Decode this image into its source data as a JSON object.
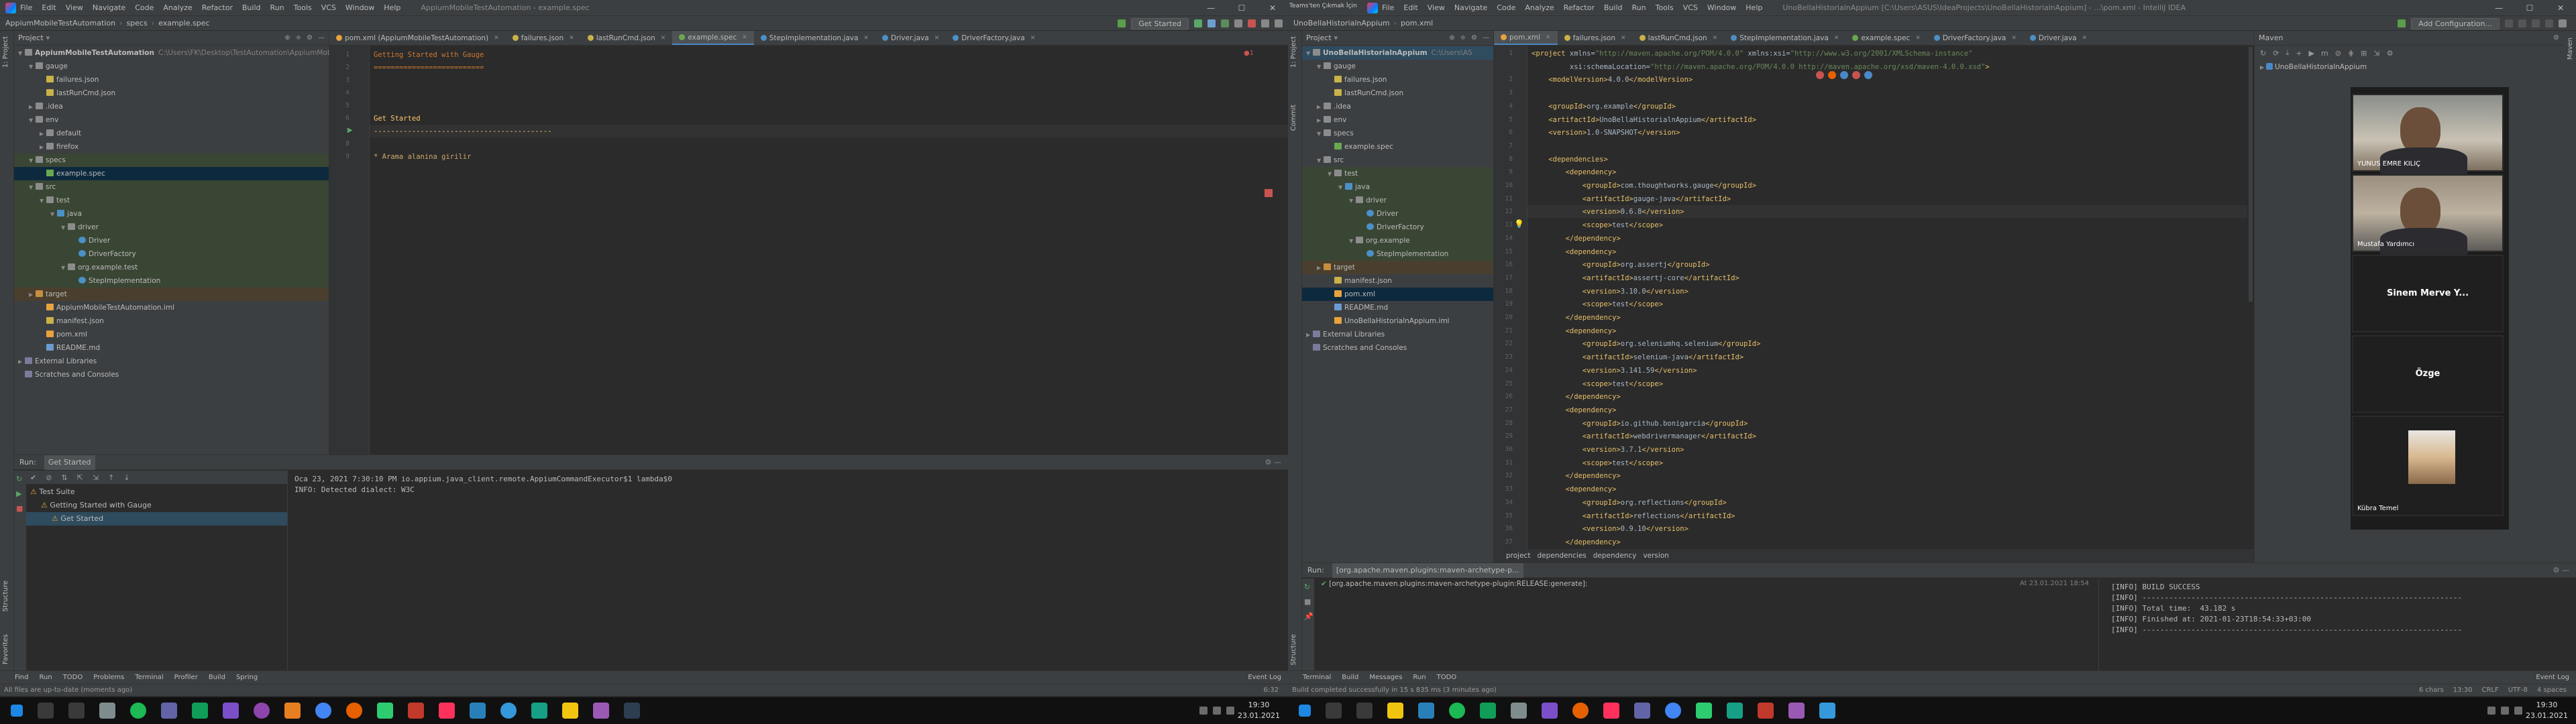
{
  "left": {
    "title": {
      "menu": [
        "File",
        "Edit",
        "View",
        "Navigate",
        "Code",
        "Analyze",
        "Refactor",
        "Build",
        "Run",
        "Tools",
        "VCS",
        "Window",
        "Help"
      ],
      "window_title": "AppiumMobileTestAutomation - example.spec"
    },
    "nav": {
      "crumbs": [
        "AppiumMobileTestAutomation",
        "specs",
        "example.spec"
      ],
      "run_config": "Get Started"
    },
    "project": {
      "header": "Project",
      "tree": [
        {
          "label": "AppiumMobileTestAutomation",
          "extra": "C:\\Users\\FK\\Desktop\\TestAutomation\\AppiumMobileTestAutomationProject",
          "indent": 0,
          "icon": "folder",
          "arrow": "▼"
        },
        {
          "label": "gauge",
          "indent": 1,
          "icon": "folder",
          "arrow": "▼"
        },
        {
          "label": "failures.json",
          "indent": 2,
          "icon": "json",
          "arrow": ""
        },
        {
          "label": "lastRunCmd.json",
          "indent": 2,
          "icon": "json",
          "arrow": ""
        },
        {
          "label": ".idea",
          "indent": 1,
          "icon": "folder",
          "arrow": "▶"
        },
        {
          "label": "env",
          "indent": 1,
          "icon": "folder",
          "arrow": "▼"
        },
        {
          "label": "default",
          "indent": 2,
          "icon": "folder",
          "arrow": "▶"
        },
        {
          "label": "firefox",
          "indent": 2,
          "icon": "folder",
          "arrow": "▶"
        },
        {
          "label": "specs",
          "indent": 1,
          "icon": "folder",
          "arrow": "▼",
          "hl": "green"
        },
        {
          "label": "example.spec",
          "indent": 2,
          "icon": "spec",
          "arrow": "",
          "hl": "sel"
        },
        {
          "label": "src",
          "indent": 1,
          "icon": "folder",
          "arrow": "▼",
          "hl": "green"
        },
        {
          "label": "test",
          "indent": 2,
          "icon": "folder",
          "arrow": "▼",
          "hl": "green"
        },
        {
          "label": "java",
          "indent": 3,
          "icon": "folder-src",
          "arrow": "▼",
          "hl": "green"
        },
        {
          "label": "driver",
          "indent": 4,
          "icon": "folder",
          "arrow": "▼",
          "hl": "green"
        },
        {
          "label": "Driver",
          "indent": 5,
          "icon": "cls",
          "arrow": "",
          "hl": "green"
        },
        {
          "label": "DriverFactory",
          "indent": 5,
          "icon": "cls",
          "arrow": "",
          "hl": "green"
        },
        {
          "label": "org.example.test",
          "indent": 4,
          "icon": "folder",
          "arrow": "▼",
          "hl": "green"
        },
        {
          "label": "StepImplementation",
          "indent": 5,
          "icon": "cls",
          "arrow": "",
          "hl": "green"
        },
        {
          "label": "target",
          "indent": 1,
          "icon": "folder-or",
          "arrow": "▶",
          "hl": "orange"
        },
        {
          "label": "AppiumMobileTestAutomation.iml",
          "indent": 2,
          "icon": "xml",
          "arrow": ""
        },
        {
          "label": "manifest.json",
          "indent": 2,
          "icon": "json",
          "arrow": ""
        },
        {
          "label": "pom.xml",
          "indent": 2,
          "icon": "xml",
          "arrow": ""
        },
        {
          "label": "README.md",
          "indent": 2,
          "icon": "md",
          "arrow": ""
        },
        {
          "label": "External Libraries",
          "indent": 0,
          "icon": "lib",
          "arrow": "▶"
        },
        {
          "label": "Scratches and Consoles",
          "indent": 0,
          "icon": "lib",
          "arrow": ""
        }
      ]
    },
    "tabs": [
      {
        "label": "pom.xml (AppiumMobileTestAutomation)",
        "color": "#e8a23e",
        "active": false
      },
      {
        "label": "failures.json",
        "color": "#c9b24a",
        "active": false
      },
      {
        "label": "lastRunCmd.json",
        "color": "#c9b24a",
        "active": false
      },
      {
        "label": "example.spec",
        "color": "#6aa84f",
        "active": true
      },
      {
        "label": "StepImplementation.java",
        "color": "#4b90c6",
        "active": false
      },
      {
        "label": "Driver.java",
        "color": "#4b90c6",
        "active": false
      },
      {
        "label": "DriverFactory.java",
        "color": "#4b90c6",
        "active": false
      }
    ],
    "code": [
      {
        "n": "1",
        "text": "Getting Started with Gauge",
        "color": "#cc7832"
      },
      {
        "n": "2",
        "text": "==========================",
        "color": "#cc7832"
      },
      {
        "n": "3",
        "text": "",
        "color": "#a9b7c6"
      },
      {
        "n": "4",
        "text": "",
        "color": "#a9b7c6"
      },
      {
        "n": "5",
        "text": "",
        "color": "#a9b7c6"
      },
      {
        "n": "6",
        "text": "Get Started",
        "color": "#ffc66d"
      },
      {
        "n": "7",
        "text": "------------------------------------------",
        "color": "#ffc66d"
      },
      {
        "n": "8",
        "text": "",
        "color": "#a9b7c6"
      },
      {
        "n": "9",
        "text": "* Arama alanina girilir",
        "color": "#d0a86a"
      }
    ],
    "run": {
      "tab_label": "Run:",
      "config": "Get Started",
      "tree": [
        {
          "label": "Test Suite",
          "indent": 0
        },
        {
          "label": "Getting Started with Gauge",
          "indent": 1
        },
        {
          "label": "Get Started",
          "indent": 2
        }
      ],
      "console": [
        "Oca 23, 2021 7:30:10 PM io.appium.java_client.remote.AppiumCommandExecutor$1 lambda$0",
        "INFO: Detected dialect: W3C"
      ]
    },
    "bottom_tabs": [
      "Find",
      "Run",
      "TODO",
      "Problems",
      "Terminal",
      "Profiler",
      "Build",
      "Spring"
    ],
    "event_log": "Event Log",
    "status": "All files are up-to-date (moments ago)",
    "position": "6:32"
  },
  "right": {
    "title": {
      "menu": [
        "File",
        "Edit",
        "View",
        "Navigate",
        "Code",
        "Analyze",
        "Refactor",
        "Build",
        "Run",
        "Tools",
        "VCS",
        "Window",
        "Help"
      ],
      "window_title": "UnoBellaHistorialnAppium [C:\\Users\\ASUS\\IdeaProjects\\UnoBellaHistorialnAppium] - ...\\pom.xml - IntelliJ IDEA",
      "overlay": "Teams'ten Çıkmak İçin"
    },
    "nav": {
      "crumbs": [
        "UnoBellaHistorialnAppium",
        "pom.xml"
      ],
      "run_config": "Add Configuration..."
    },
    "project": {
      "header": "Project",
      "tree": [
        {
          "label": "UnoBellaHistorialnAppium",
          "extra": "C:\\Users\\AS",
          "indent": 0,
          "icon": "folder",
          "arrow": "▼",
          "hl": "sel2"
        },
        {
          "label": "gauge",
          "indent": 1,
          "icon": "folder",
          "arrow": "▼"
        },
        {
          "label": "failures.json",
          "indent": 2,
          "icon": "json",
          "arrow": ""
        },
        {
          "label": "lastRunCmd.json",
          "indent": 2,
          "icon": "json",
          "arrow": ""
        },
        {
          "label": ".idea",
          "indent": 1,
          "icon": "folder",
          "arrow": "▶"
        },
        {
          "label": "env",
          "indent": 1,
          "icon": "folder",
          "arrow": "▶"
        },
        {
          "label": "specs",
          "indent": 1,
          "icon": "folder",
          "arrow": "▼"
        },
        {
          "label": "example.spec",
          "indent": 2,
          "icon": "spec",
          "arrow": ""
        },
        {
          "label": "src",
          "indent": 1,
          "icon": "folder",
          "arrow": "▼"
        },
        {
          "label": "test",
          "indent": 2,
          "icon": "folder",
          "arrow": "▼",
          "hl": "green"
        },
        {
          "label": "java",
          "indent": 3,
          "icon": "folder-src",
          "arrow": "▼",
          "hl": "green"
        },
        {
          "label": "driver",
          "indent": 4,
          "icon": "folder",
          "arrow": "▼",
          "hl": "green"
        },
        {
          "label": "Driver",
          "indent": 5,
          "icon": "cls",
          "arrow": "",
          "hl": "green"
        },
        {
          "label": "DriverFactory",
          "indent": 5,
          "icon": "cls",
          "arrow": "",
          "hl": "green"
        },
        {
          "label": "org.example",
          "indent": 4,
          "icon": "folder",
          "arrow": "▼",
          "hl": "green"
        },
        {
          "label": "StepImplementation",
          "indent": 5,
          "icon": "cls",
          "arrow": "",
          "hl": "green"
        },
        {
          "label": "target",
          "indent": 1,
          "icon": "folder-or",
          "arrow": "▶",
          "hl": "orange"
        },
        {
          "label": "manifest.json",
          "indent": 2,
          "icon": "json",
          "arrow": ""
        },
        {
          "label": "pom.xml",
          "indent": 2,
          "icon": "xml",
          "arrow": "",
          "hl": "sel"
        },
        {
          "label": "README.md",
          "indent": 2,
          "icon": "md",
          "arrow": ""
        },
        {
          "label": "UnoBellaHistorialnAppium.iml",
          "indent": 2,
          "icon": "xml",
          "arrow": ""
        },
        {
          "label": "External Libraries",
          "indent": 0,
          "icon": "lib",
          "arrow": "▶"
        },
        {
          "label": "Scratches and Consoles",
          "indent": 0,
          "icon": "lib",
          "arrow": ""
        }
      ]
    },
    "tabs": [
      {
        "label": "pom.xml",
        "color": "#e8a23e",
        "active": true
      },
      {
        "label": "failures.json",
        "color": "#c9b24a",
        "active": false
      },
      {
        "label": "lastRunCmd.json",
        "color": "#c9b24a",
        "active": false
      },
      {
        "label": "StepImplementation.java",
        "color": "#4b90c6",
        "active": false
      },
      {
        "label": "example.spec",
        "color": "#6aa84f",
        "active": false
      },
      {
        "label": "DriverFactory.java",
        "color": "#4b90c6",
        "active": false
      },
      {
        "label": "Driver.java",
        "color": "#4b90c6",
        "active": false
      }
    ],
    "code": [
      {
        "n": "1",
        "text": "<project xmlns=\"http://maven.apache.org/POM/4.0.0\" xmlns:xsi=\"http://www.w3.org/2001/XMLSchema-instance\""
      },
      {
        "n": "",
        "text": "         xsi:schemaLocation=\"http://maven.apache.org/POM/4.0.0 http://maven.apache.org/xsd/maven-4.0.0.xsd\">"
      },
      {
        "n": "2",
        "text": "    <modelVersion>4.0.0</modelVersion>"
      },
      {
        "n": "3",
        "text": ""
      },
      {
        "n": "4",
        "text": "    <groupId>org.example</groupId>"
      },
      {
        "n": "5",
        "text": "    <artifactId>UnoBellaHistorialnAppium</artifactId>"
      },
      {
        "n": "6",
        "text": "    <version>1.0-SNAPSHOT</version>"
      },
      {
        "n": "7",
        "text": ""
      },
      {
        "n": "8",
        "text": "    <dependencies>"
      },
      {
        "n": "9",
        "text": "        <dependency>"
      },
      {
        "n": "10",
        "text": "            <groupId>com.thoughtworks.gauge</groupId>"
      },
      {
        "n": "11",
        "text": "            <artifactId>gauge-java</artifactId>"
      },
      {
        "n": "12",
        "text": "            <version>0.6.8</version>"
      },
      {
        "n": "13",
        "text": "            <scope>test</scope>"
      },
      {
        "n": "14",
        "text": "        </dependency>"
      },
      {
        "n": "15",
        "text": "        <dependency>"
      },
      {
        "n": "16",
        "text": "            <groupId>org.assertj</groupId>"
      },
      {
        "n": "17",
        "text": "            <artifactId>assertj-core</artifactId>"
      },
      {
        "n": "18",
        "text": "            <version>3.10.0</version>"
      },
      {
        "n": "19",
        "text": "            <scope>test</scope>"
      },
      {
        "n": "20",
        "text": "        </dependency>"
      },
      {
        "n": "21",
        "text": "        <dependency>"
      },
      {
        "n": "22",
        "text": "            <groupId>org.seleniumhq.selenium</groupId>"
      },
      {
        "n": "23",
        "text": "            <artifactId>selenium-java</artifactId>"
      },
      {
        "n": "24",
        "text": "            <version>3.141.59</version>"
      },
      {
        "n": "25",
        "text": "            <scope>test</scope>"
      },
      {
        "n": "26",
        "text": "        </dependency>"
      },
      {
        "n": "27",
        "text": "        <dependency>"
      },
      {
        "n": "28",
        "text": "            <groupId>io.github.bonigarcia</groupId>"
      },
      {
        "n": "29",
        "text": "            <artifactId>webdrivermanager</artifactId>"
      },
      {
        "n": "30",
        "text": "            <version>3.7.1</version>"
      },
      {
        "n": "31",
        "text": "            <scope>test</scope>"
      },
      {
        "n": "32",
        "text": "        </dependency>"
      },
      {
        "n": "33",
        "text": "        <dependency>"
      },
      {
        "n": "34",
        "text": "            <groupId>org.reflections</groupId>"
      },
      {
        "n": "35",
        "text": "            <artifactId>reflections</artifactId>"
      },
      {
        "n": "36",
        "text": "            <version>0.9.10</version>"
      },
      {
        "n": "37",
        "text": "        </dependency>"
      }
    ],
    "breadcrumb": [
      "project",
      "dependencies",
      "dependency",
      "version"
    ],
    "maven_label": "Maven",
    "maven_item": "UnoBellaHistorialnAppium",
    "run": {
      "tab_label": "Run:",
      "config": "[org.apache.maven.plugins:maven-archetype-p...",
      "tree_item": "[org.apache.maven.plugins:maven-archetype-plugin:RELEASE:generate]:",
      "tree_time": "At 23.01.2021 18:54",
      "console": [
        "[INFO] BUILD SUCCESS",
        "[INFO] ------------------------------------------------------------------------",
        "[INFO] Total time:  43.182 s",
        "[INFO] Finished at: 2021-01-23T18:54:33+03:00",
        "[INFO] ------------------------------------------------------------------------"
      ]
    },
    "bottom_tabs": [
      "Terminal",
      "Build",
      "Messages",
      "Run",
      "TODO"
    ],
    "event_log": "Event Log",
    "status": "Build completed successfully in 15 s 835 ms (3 minutes ago)",
    "status_right": [
      "6 chars",
      "13:30",
      "CRLF",
      "UTF-8",
      "4 spaces"
    ],
    "participants": [
      {
        "name": "YUNUS EMRE KILIÇ",
        "video": true
      },
      {
        "name": "Mustafa Yardımcı",
        "video": true
      },
      {
        "name": "Sinem  Merve Y...",
        "video": false
      },
      {
        "name": "Özge",
        "video": false
      },
      {
        "name": "Kübra Temel",
        "video": false,
        "avatar": true
      }
    ]
  },
  "taskbar": {
    "left_time": "19:30",
    "left_date": "23.01.2021",
    "right_time": "19:30",
    "right_date": "23.01.2021"
  },
  "colors": {
    "keyword_xml": "#e8bf6a",
    "text": "#a9b7c6",
    "attr_value": "#6a8759",
    "spec_heading": "#cc7832"
  }
}
